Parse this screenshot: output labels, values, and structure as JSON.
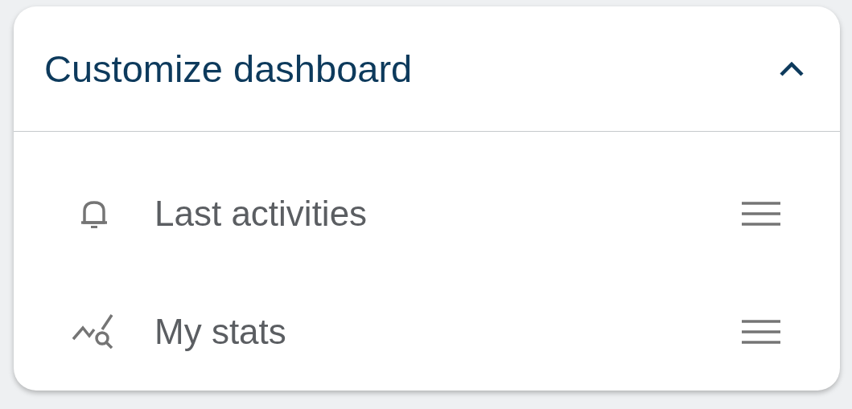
{
  "panel": {
    "title": "Customize dashboard",
    "expanded": true
  },
  "items": [
    {
      "kind": "bell",
      "label": "Last activities"
    },
    {
      "kind": "stats",
      "label": "My stats"
    }
  ]
}
